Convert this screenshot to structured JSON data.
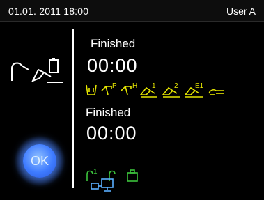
{
  "header": {
    "datetime": "01.01. 2011 18:00",
    "user": "User A"
  },
  "ok_button": {
    "label": "OK"
  },
  "block1": {
    "status": "Finished",
    "time": "00:00"
  },
  "block2": {
    "status": "Finished",
    "time": "00:00"
  },
  "tool_labels": {
    "superscript_1": "1",
    "superscript_2": "2",
    "superscript_e1": "E1",
    "p_letter": "P",
    "h_letter": "H",
    "green_superscript_1": "1"
  },
  "colors": {
    "background": "#000000",
    "text": "#ffffff",
    "yellow_icons": "#e6e600",
    "green_icons": "#3cc43c",
    "ok_button": "#3e7bff",
    "divider": "#ffffff",
    "network_icon": "#5ab0ff"
  },
  "icons": [
    "tube-instrument-icon",
    "cup-icon",
    "handpiece-p-icon",
    "handpiece-h-icon",
    "motor-1-icon",
    "motor-2-icon",
    "motor-e1-icon",
    "scaler-icon",
    "tube-1-icon",
    "tube-icon",
    "tray-icon",
    "network-icon"
  ]
}
